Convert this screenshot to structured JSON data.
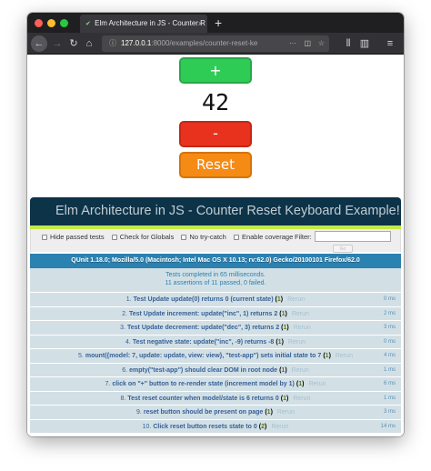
{
  "browser": {
    "tab_title": "Elm Architecture in JS - Counter R",
    "tab_close": "×",
    "new_tab": "+",
    "url_host": "127.0.0.1",
    "url_rest": ":8000/examples/counter-reset-ke",
    "icons": {
      "back": "←",
      "forward": "→",
      "reload": "↻",
      "home": "⌂",
      "info": "ⓘ",
      "more": "···",
      "pocket": "◫",
      "star": "☆",
      "library": "⫴",
      "sidebar": "▥",
      "menu": "≡"
    }
  },
  "app": {
    "increment_label": "+",
    "count": "42",
    "decrement_label": "-",
    "reset_label": "Reset",
    "colors": {
      "increment": "#2ecc55",
      "decrement": "#e8321e",
      "reset": "#f58a15"
    }
  },
  "qunit": {
    "header": "Elm Architecture in JS - Counter Reset Keyboard Example!",
    "options": {
      "hide_passed": "Hide passed tests",
      "check_globals": "Check for Globals",
      "no_try_catch": "No try-catch",
      "enable_coverage": "Enable coverage",
      "filter_label": "Filter:",
      "go": "Go"
    },
    "user_agent": "QUnit 1.18.0; Mozilla/5.0 (Macintosh; Intel Mac OS X 10.13; rv:62.0) Gecko/20100101 Firefox/62.0",
    "result_line1": "Tests completed in 65 milliseconds.",
    "result_line2": "11 assertions of 11 passed, 0 failed.",
    "tests": [
      {
        "num": "1.",
        "name": "Test Update update(0) returns 0 (current state)",
        "count": "1",
        "runtime": "0 ms"
      },
      {
        "num": "2.",
        "name": "Test Update increment: update(\"inc\", 1) returns 2",
        "count": "1",
        "runtime": "2 ms"
      },
      {
        "num": "3.",
        "name": "Test Update decrement: update(\"dec\", 3) returns 2",
        "count": "1",
        "runtime": "3 ms"
      },
      {
        "num": "4.",
        "name": "Test negative state: update(\"inc\", -9) returns -8",
        "count": "1",
        "runtime": "0 ms"
      },
      {
        "num": "5.",
        "name": "mount({model: 7, update: update, view: view}, \"test-app\") sets initial state to 7",
        "count": "1",
        "runtime": "4 ms"
      },
      {
        "num": "6.",
        "name": "empty(\"test-app\") should clear DOM in root node",
        "count": "1",
        "runtime": "1 ms"
      },
      {
        "num": "7.",
        "name": "click on \"+\" button to re-render state (increment model by 1)",
        "count": "1",
        "runtime": "6 ms"
      },
      {
        "num": "8.",
        "name": "Test reset counter when model/state is 6 returns 0",
        "count": "1",
        "runtime": "1 ms"
      },
      {
        "num": "9.",
        "name": "reset button should be present on page",
        "count": "1",
        "runtime": "3 ms"
      },
      {
        "num": "10.",
        "name": "Click reset button resets state to 0",
        "count": "2",
        "runtime": "14 ms"
      }
    ],
    "rerun_label": "Rerun"
  }
}
